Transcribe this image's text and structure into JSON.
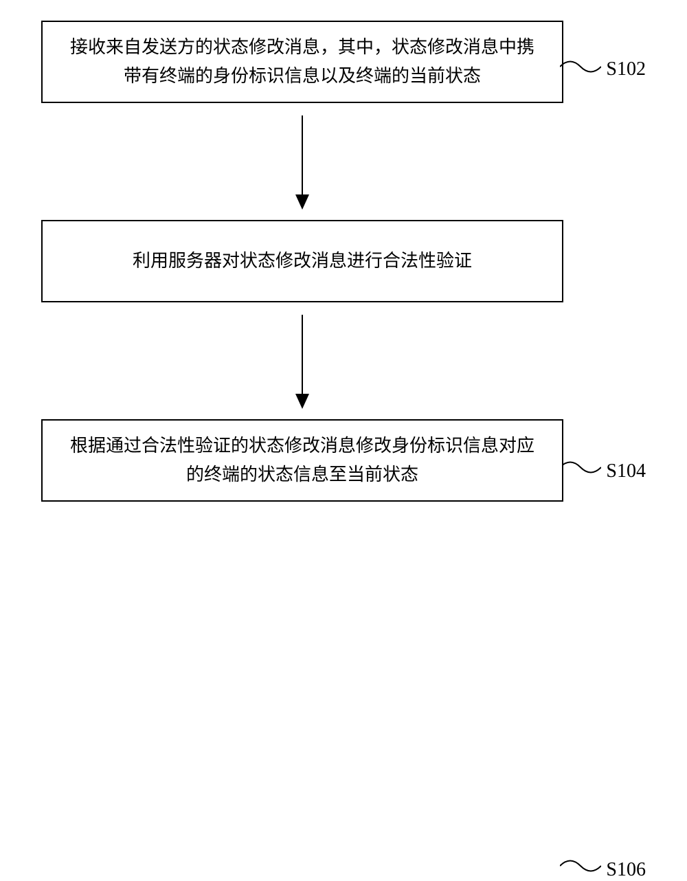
{
  "flowchart": {
    "steps": [
      {
        "text": "接收来自发送方的状态修改消息，其中，状态修改消息中携带有终端的身份标识信息以及终端的当前状态",
        "label": "S102"
      },
      {
        "text": "利用服务器对状态修改消息进行合法性验证",
        "label": "S104"
      },
      {
        "text": "根据通过合法性验证的状态修改消息修改身份标识信息对应的终端的状态信息至当前状态",
        "label": "S106"
      }
    ]
  }
}
